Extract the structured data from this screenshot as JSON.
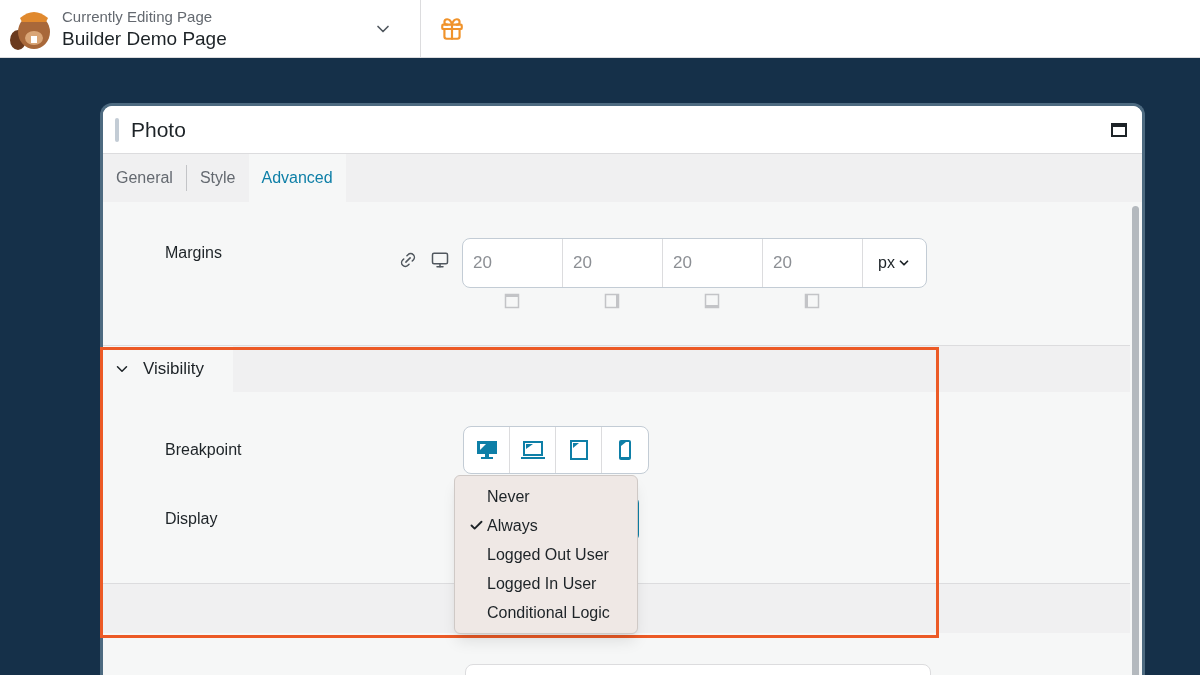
{
  "header": {
    "subtitle": "Currently Editing Page",
    "title": "Builder Demo Page"
  },
  "panel": {
    "title": "Photo",
    "tabs": [
      {
        "label": "General",
        "selected": false
      },
      {
        "label": "Style",
        "selected": false
      },
      {
        "label": "Advanced",
        "selected": true
      }
    ]
  },
  "margins": {
    "label": "Margins",
    "values": [
      "20",
      "20",
      "20",
      "20"
    ],
    "unit": "px"
  },
  "visibility": {
    "label": "Visibility",
    "expanded": true,
    "breakpoint_label": "Breakpoint",
    "display_label": "Display",
    "menu": [
      {
        "label": "Never",
        "selected": false
      },
      {
        "label": "Always",
        "selected": true
      },
      {
        "label": "Logged Out User",
        "selected": false
      },
      {
        "label": "Logged In User",
        "selected": false
      },
      {
        "label": "Conditional Logic",
        "selected": false
      }
    ]
  }
}
